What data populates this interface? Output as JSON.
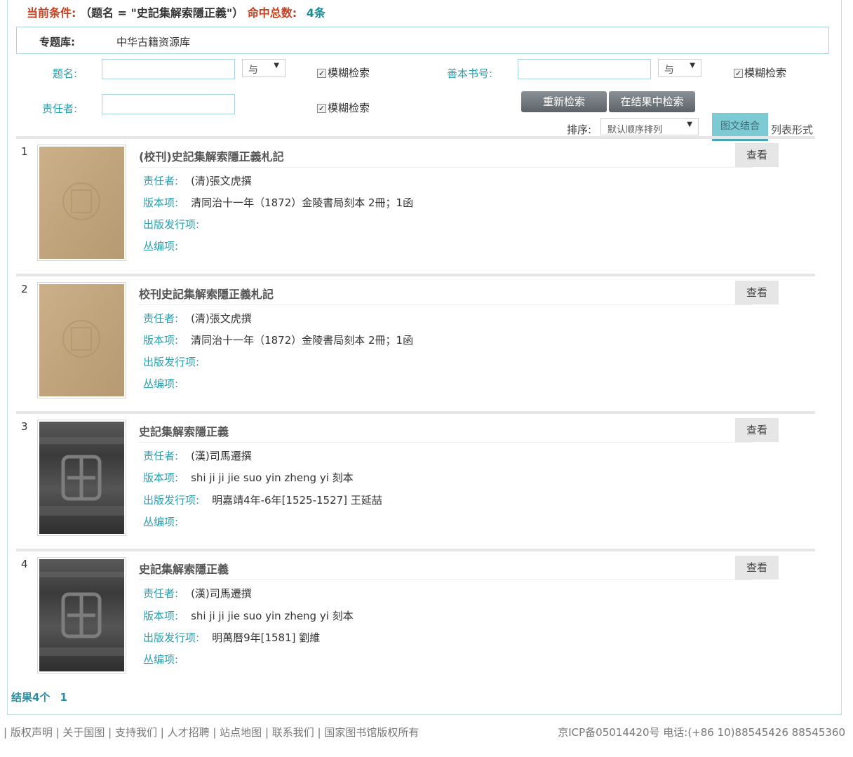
{
  "condition": {
    "label": "当前条件:",
    "expr": "（题名 = \"史記集解索隱正義\"）",
    "hits_label": "命中总数:",
    "hits": "4条"
  },
  "topic": {
    "label": "专题库:",
    "value": "中华古籍资源库"
  },
  "form": {
    "title_label": "题名:",
    "title_value": "",
    "op1": "与",
    "fuzzy1": "模糊检索",
    "rare_label": "善本书号:",
    "rare_value": "",
    "op2": "与",
    "fuzzy2": "模糊检索",
    "author_label": "责任者:",
    "author_value": "",
    "fuzzy3": "模糊检索",
    "research_btn": "重新检索",
    "within_btn": "在结果中检索"
  },
  "sort": {
    "label": "排序:",
    "selected": "默认顺序排列",
    "view_active": "图文结合",
    "view_other": "列表形式"
  },
  "field_labels": {
    "author": "责任者:",
    "edition": "版本项:",
    "publish": "出版发行项:",
    "series": "丛编项:"
  },
  "records": [
    {
      "index": "1",
      "title": "(校刊)史記集解索隱正義札記",
      "author": "(清)張文虎撰",
      "edition": "清同治十一年（1872）金陵書局刻本 2冊；1函",
      "publish": "",
      "series": "",
      "view": "查看",
      "thumb_style": "tan"
    },
    {
      "index": "2",
      "title": "校刊史記集解索隱正義札記",
      "author": "(清)張文虎撰",
      "edition": "清同治十一年（1872）金陵書局刻本 2冊；1函",
      "publish": "",
      "series": "",
      "view": "查看",
      "thumb_style": "tan"
    },
    {
      "index": "3",
      "title": "史記集解索隱正義",
      "author": "(漢)司馬遷撰",
      "edition": "shi ji ji jie suo yin zheng yi 刻本",
      "publish": "明嘉靖4年-6年[1525-1527] 王延喆",
      "series": "",
      "view": "查看",
      "thumb_style": "dark"
    },
    {
      "index": "4",
      "title": "史記集解索隱正義",
      "author": "(漢)司馬遷撰",
      "edition": "shi ji ji jie suo yin zheng yi 刻本",
      "publish": "明萬曆9年[1581] 劉維",
      "series": "",
      "view": "查看",
      "thumb_style": "dark"
    }
  ],
  "results": {
    "count": "结果4个",
    "page": "1"
  },
  "footer": {
    "links": "| 版权声明 | 关于国图 | 支持我们 | 人才招聘 | 站点地图 | 联系我们 | 国家图书馆版权所有",
    "right": "京ICP备05014420号 电话:(+86 10)88545426 88545360"
  },
  "colors": {
    "accent": "#2a9fad",
    "condition_label": "#c8401d",
    "tab_active": "#7ccad4"
  }
}
